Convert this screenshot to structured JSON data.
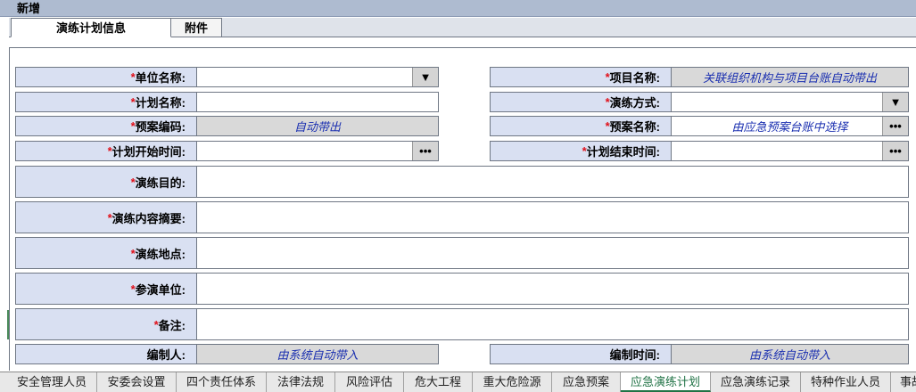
{
  "window": {
    "title": "新增"
  },
  "tabs": [
    {
      "label": "演练计划信息",
      "active": true
    },
    {
      "label": "附件",
      "active": false
    }
  ],
  "form": {
    "unit_name": {
      "label": "单位名称:",
      "required": true,
      "value": ""
    },
    "project_name": {
      "label": "项目名称:",
      "required": true,
      "value": "关联组织机构与项目台账自动带出"
    },
    "plan_name": {
      "label": "计划名称:",
      "required": true,
      "value": ""
    },
    "drill_method": {
      "label": "演练方式:",
      "required": true,
      "value": ""
    },
    "plan_code": {
      "label": "预案编码:",
      "required": true,
      "value": "自动带出"
    },
    "plan_title": {
      "label": "预案名称:",
      "required": true,
      "value": "由应急预案台账中选择"
    },
    "start_time": {
      "label": "计划开始时间:",
      "required": true,
      "value": ""
    },
    "end_time": {
      "label": "计划结束时间:",
      "required": true,
      "value": ""
    },
    "purpose": {
      "label": "演练目的:",
      "required": true,
      "value": ""
    },
    "summary": {
      "label": "演练内容摘要:",
      "required": true,
      "value": ""
    },
    "location": {
      "label": "演练地点:",
      "required": true,
      "value": ""
    },
    "participants": {
      "label": "参演单位:",
      "required": true,
      "value": ""
    },
    "remarks": {
      "label": "备注:",
      "required": true,
      "value": ""
    },
    "editor": {
      "label": "编制人:",
      "required": false,
      "value": "由系统自动带入"
    },
    "edit_time": {
      "label": "编制时间:",
      "required": false,
      "value": "由系统自动带入"
    }
  },
  "icons": {
    "dropdown": "▼",
    "ellipsis": "•••",
    "required_mark": "*"
  },
  "sheets": [
    "安全管理人员",
    "安委会设置",
    "四个责任体系",
    "法律法规",
    "风险评估",
    "危大工程",
    "重大危险源",
    "应急预案",
    "应急演练计划",
    "应急演练记录",
    "特种作业人员",
    "事故"
  ],
  "active_sheet": "应急演练计划",
  "colors": {
    "label_bg": "#d9e0f2",
    "required": "#e0101a",
    "auto_text": "#1a2fb0",
    "active_sheet": "#217346"
  }
}
